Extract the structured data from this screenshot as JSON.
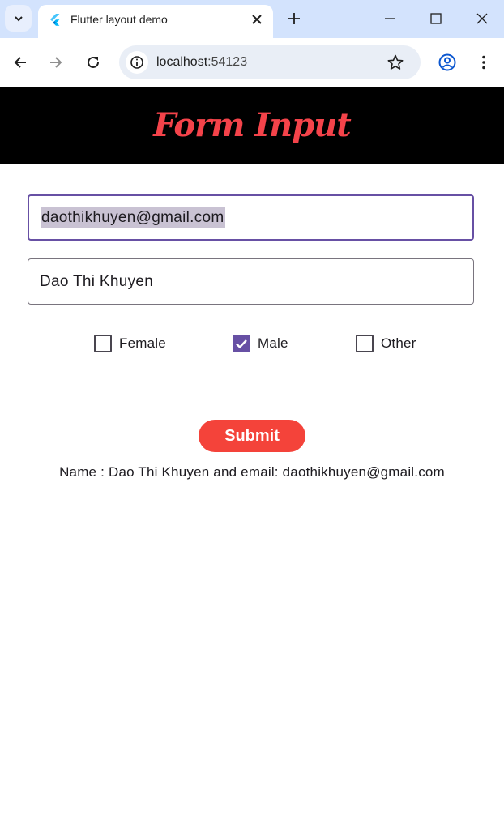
{
  "browser": {
    "tab_title": "Flutter layout demo",
    "url_host": "localhost",
    "url_port": ":54123",
    "icons": [
      "tab-search-icon",
      "flutter-icon",
      "close-icon",
      "plus-icon",
      "minimize-icon",
      "maximize-icon",
      "window-close-icon",
      "back-icon",
      "forward-icon",
      "reload-icon",
      "site-info-icon",
      "star-icon",
      "profile-icon",
      "menu-icon"
    ]
  },
  "app": {
    "title": "Form Input",
    "title_color": "#f4434a",
    "email_value": "daothikhuyen@gmail.com",
    "name_value": "Dao Thi Khuyen",
    "checkboxes": [
      {
        "label": "Female",
        "checked": false
      },
      {
        "label": "Male",
        "checked": true
      },
      {
        "label": "Other",
        "checked": false
      }
    ],
    "submit_label": "Submit",
    "submit_color": "#f4433a",
    "accent_color": "#6750a4",
    "result_text": "Name : Dao Thi Khuyen and email: daothikhuyen@gmail.com"
  }
}
